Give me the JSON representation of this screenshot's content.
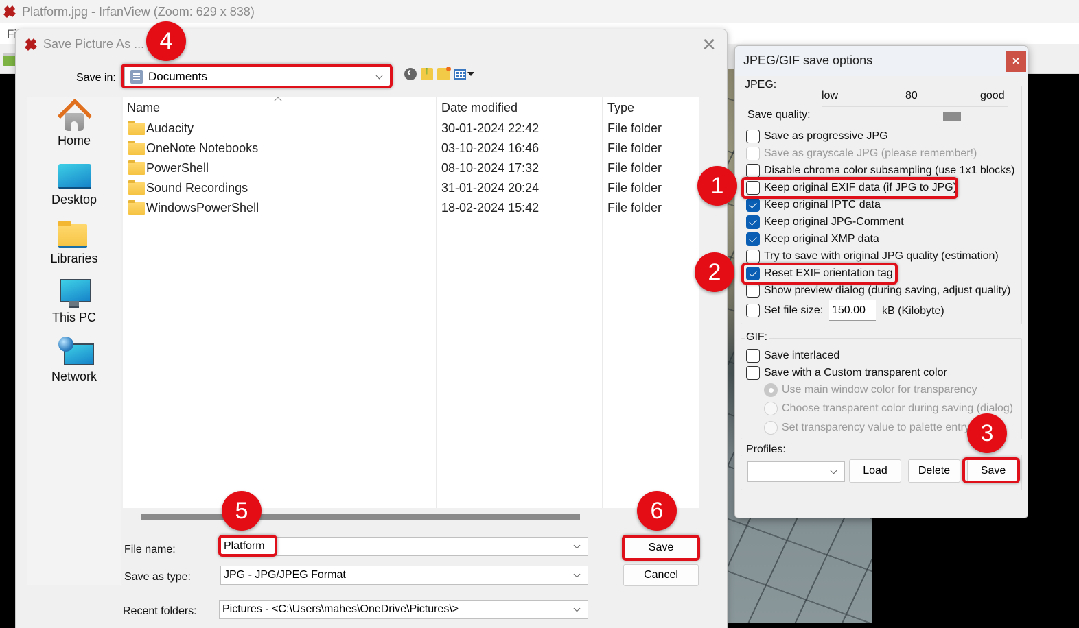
{
  "app": {
    "title": "Platform.jpg - IrfanView (Zoom: 629 x 838)",
    "menu_file_partial": "Fi"
  },
  "save_dialog": {
    "title": "Save Picture As ...",
    "save_in_label": "Save in:",
    "save_in_value": "Documents",
    "nav_icons": [
      "back-icon",
      "up-folder-icon",
      "new-folder-icon",
      "view-menu-icon"
    ],
    "places": [
      {
        "label": "Home",
        "icon": "home-icon"
      },
      {
        "label": "Desktop",
        "icon": "desktop-icon"
      },
      {
        "label": "Libraries",
        "icon": "libraries-icon"
      },
      {
        "label": "This PC",
        "icon": "this-pc-icon"
      },
      {
        "label": "Network",
        "icon": "network-icon"
      }
    ],
    "columns": [
      "Name",
      "Date modified",
      "Type"
    ],
    "files": [
      {
        "name": "Audacity",
        "date": "30-01-2024 22:42",
        "type": "File folder"
      },
      {
        "name": "OneNote Notebooks",
        "date": "03-10-2024 16:46",
        "type": "File folder"
      },
      {
        "name": "PowerShell",
        "date": "08-10-2024 17:32",
        "type": "File folder"
      },
      {
        "name": "Sound Recordings",
        "date": "31-01-2024 20:24",
        "type": "File folder"
      },
      {
        "name": "WindowsPowerShell",
        "date": "18-02-2024 15:42",
        "type": "File folder"
      }
    ],
    "file_name_label": "File name:",
    "file_name_value": "Platform",
    "save_as_type_label": "Save as type:",
    "save_as_type_value": "JPG - JPG/JPEG Format",
    "recent_folders_label": "Recent folders:",
    "recent_folders_value": "Pictures  -  <C:\\Users\\mahes\\OneDrive\\Pictures\\>",
    "save_button": "Save",
    "cancel_button": "Cancel"
  },
  "options_dialog": {
    "title": "JPEG/GIF save options",
    "close_label": "×",
    "jpeg_group": "JPEG:",
    "quality_low": "low",
    "quality_value": "80",
    "quality_good": "good",
    "save_quality_label": "Save quality:",
    "quality_fraction": 0.8,
    "jpeg_options": [
      {
        "label": "Save as progressive JPG",
        "checked": false,
        "disabled": false
      },
      {
        "label": "Save as grayscale JPG (please remember!)",
        "checked": false,
        "disabled": true
      },
      {
        "label": "Disable chroma color subsampling (use 1x1 blocks)",
        "checked": false,
        "disabled": false
      },
      {
        "label": "Keep original EXIF data (if JPG to JPG)",
        "checked": false,
        "disabled": false
      },
      {
        "label": "Keep original IPTC data",
        "checked": true,
        "disabled": false
      },
      {
        "label": "Keep original JPG-Comment",
        "checked": true,
        "disabled": false
      },
      {
        "label": "Keep original XMP data",
        "checked": true,
        "disabled": false
      },
      {
        "label": "Try to save with original JPG quality (estimation)",
        "checked": false,
        "disabled": false
      },
      {
        "label": "Reset EXIF orientation tag",
        "checked": true,
        "disabled": false
      },
      {
        "label": "Show preview dialog (during saving, adjust quality)",
        "checked": false,
        "disabled": false
      }
    ],
    "set_file_size_label": "Set file size:",
    "set_file_size_checked": false,
    "file_size_value": "150.00",
    "file_size_unit": "kB (Kilobyte)",
    "gif_group": "GIF:",
    "gif_options": [
      {
        "label": "Save interlaced",
        "checked": false
      },
      {
        "label": "Save with a Custom transparent color",
        "checked": false
      }
    ],
    "gif_radios": [
      {
        "label": "Use main window color for transparency",
        "selected": true
      },
      {
        "label": "Choose transparent color during saving (dialog)",
        "selected": false
      },
      {
        "label": "Set transparency value to palette entry:",
        "selected": false
      }
    ],
    "profiles_group": "Profiles:",
    "profiles_value": "",
    "load_button": "Load",
    "delete_button": "Delete",
    "save_button": "Save"
  },
  "annotations": {
    "badges": [
      "1",
      "2",
      "3",
      "4",
      "5",
      "6"
    ],
    "highlight_color": "#e0101a"
  }
}
